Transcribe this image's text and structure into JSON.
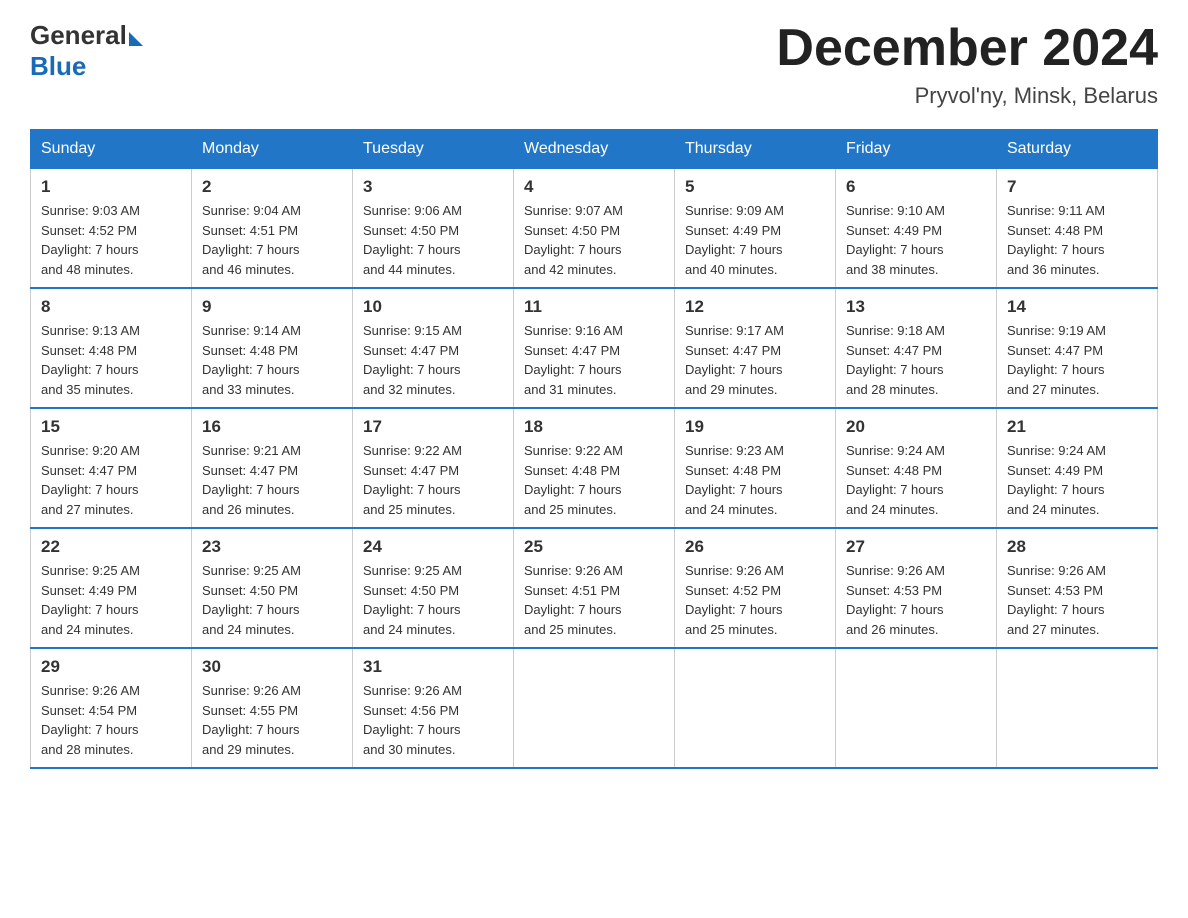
{
  "logo": {
    "general": "General",
    "blue": "Blue"
  },
  "title": "December 2024",
  "subtitle": "Pryvol'ny, Minsk, Belarus",
  "days_of_week": [
    "Sunday",
    "Monday",
    "Tuesday",
    "Wednesday",
    "Thursday",
    "Friday",
    "Saturday"
  ],
  "weeks": [
    [
      {
        "day": "1",
        "sunrise": "9:03 AM",
        "sunset": "4:52 PM",
        "daylight": "7 hours and 48 minutes."
      },
      {
        "day": "2",
        "sunrise": "9:04 AM",
        "sunset": "4:51 PM",
        "daylight": "7 hours and 46 minutes."
      },
      {
        "day": "3",
        "sunrise": "9:06 AM",
        "sunset": "4:50 PM",
        "daylight": "7 hours and 44 minutes."
      },
      {
        "day": "4",
        "sunrise": "9:07 AM",
        "sunset": "4:50 PM",
        "daylight": "7 hours and 42 minutes."
      },
      {
        "day": "5",
        "sunrise": "9:09 AM",
        "sunset": "4:49 PM",
        "daylight": "7 hours and 40 minutes."
      },
      {
        "day": "6",
        "sunrise": "9:10 AM",
        "sunset": "4:49 PM",
        "daylight": "7 hours and 38 minutes."
      },
      {
        "day": "7",
        "sunrise": "9:11 AM",
        "sunset": "4:48 PM",
        "daylight": "7 hours and 36 minutes."
      }
    ],
    [
      {
        "day": "8",
        "sunrise": "9:13 AM",
        "sunset": "4:48 PM",
        "daylight": "7 hours and 35 minutes."
      },
      {
        "day": "9",
        "sunrise": "9:14 AM",
        "sunset": "4:48 PM",
        "daylight": "7 hours and 33 minutes."
      },
      {
        "day": "10",
        "sunrise": "9:15 AM",
        "sunset": "4:47 PM",
        "daylight": "7 hours and 32 minutes."
      },
      {
        "day": "11",
        "sunrise": "9:16 AM",
        "sunset": "4:47 PM",
        "daylight": "7 hours and 31 minutes."
      },
      {
        "day": "12",
        "sunrise": "9:17 AM",
        "sunset": "4:47 PM",
        "daylight": "7 hours and 29 minutes."
      },
      {
        "day": "13",
        "sunrise": "9:18 AM",
        "sunset": "4:47 PM",
        "daylight": "7 hours and 28 minutes."
      },
      {
        "day": "14",
        "sunrise": "9:19 AM",
        "sunset": "4:47 PM",
        "daylight": "7 hours and 27 minutes."
      }
    ],
    [
      {
        "day": "15",
        "sunrise": "9:20 AM",
        "sunset": "4:47 PM",
        "daylight": "7 hours and 27 minutes."
      },
      {
        "day": "16",
        "sunrise": "9:21 AM",
        "sunset": "4:47 PM",
        "daylight": "7 hours and 26 minutes."
      },
      {
        "day": "17",
        "sunrise": "9:22 AM",
        "sunset": "4:47 PM",
        "daylight": "7 hours and 25 minutes."
      },
      {
        "day": "18",
        "sunrise": "9:22 AM",
        "sunset": "4:48 PM",
        "daylight": "7 hours and 25 minutes."
      },
      {
        "day": "19",
        "sunrise": "9:23 AM",
        "sunset": "4:48 PM",
        "daylight": "7 hours and 24 minutes."
      },
      {
        "day": "20",
        "sunrise": "9:24 AM",
        "sunset": "4:48 PM",
        "daylight": "7 hours and 24 minutes."
      },
      {
        "day": "21",
        "sunrise": "9:24 AM",
        "sunset": "4:49 PM",
        "daylight": "7 hours and 24 minutes."
      }
    ],
    [
      {
        "day": "22",
        "sunrise": "9:25 AM",
        "sunset": "4:49 PM",
        "daylight": "7 hours and 24 minutes."
      },
      {
        "day": "23",
        "sunrise": "9:25 AM",
        "sunset": "4:50 PM",
        "daylight": "7 hours and 24 minutes."
      },
      {
        "day": "24",
        "sunrise": "9:25 AM",
        "sunset": "4:50 PM",
        "daylight": "7 hours and 24 minutes."
      },
      {
        "day": "25",
        "sunrise": "9:26 AM",
        "sunset": "4:51 PM",
        "daylight": "7 hours and 25 minutes."
      },
      {
        "day": "26",
        "sunrise": "9:26 AM",
        "sunset": "4:52 PM",
        "daylight": "7 hours and 25 minutes."
      },
      {
        "day": "27",
        "sunrise": "9:26 AM",
        "sunset": "4:53 PM",
        "daylight": "7 hours and 26 minutes."
      },
      {
        "day": "28",
        "sunrise": "9:26 AM",
        "sunset": "4:53 PM",
        "daylight": "7 hours and 27 minutes."
      }
    ],
    [
      {
        "day": "29",
        "sunrise": "9:26 AM",
        "sunset": "4:54 PM",
        "daylight": "7 hours and 28 minutes."
      },
      {
        "day": "30",
        "sunrise": "9:26 AM",
        "sunset": "4:55 PM",
        "daylight": "7 hours and 29 minutes."
      },
      {
        "day": "31",
        "sunrise": "9:26 AM",
        "sunset": "4:56 PM",
        "daylight": "7 hours and 30 minutes."
      },
      null,
      null,
      null,
      null
    ]
  ],
  "labels": {
    "sunrise": "Sunrise:",
    "sunset": "Sunset:",
    "daylight": "Daylight:"
  }
}
